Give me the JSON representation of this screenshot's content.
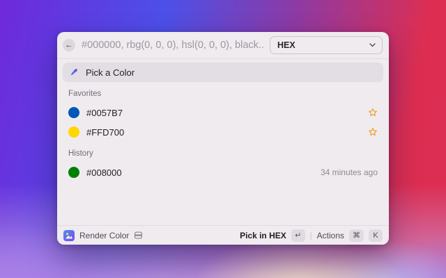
{
  "header": {
    "back_icon": "←",
    "search_placeholder": "#000000, rbg(0, 0, 0), hsl(0, 0, 0), black...",
    "format_dropdown": {
      "value": "HEX"
    }
  },
  "pick_action": {
    "label": "Pick a Color"
  },
  "favorites": {
    "title": "Favorites",
    "rows": [
      {
        "label": "#0057B7",
        "swatch": "#0057B7"
      },
      {
        "label": "#FFD700",
        "swatch": "#FFD700"
      }
    ]
  },
  "history": {
    "title": "History",
    "rows": [
      {
        "label": "#008000",
        "swatch": "#008000",
        "timestamp": "34 minutes ago"
      }
    ]
  },
  "footer": {
    "app_name": "Render Color",
    "primary_action": "Pick in HEX",
    "primary_key": "↵",
    "actions_label": "Actions",
    "cmd_key": "⌘",
    "k_key": "K"
  },
  "colors": {
    "star": "#F2A33C",
    "accent_blue": "#0057B7",
    "accent_yellow": "#FFD700",
    "accent_green": "#008000"
  }
}
